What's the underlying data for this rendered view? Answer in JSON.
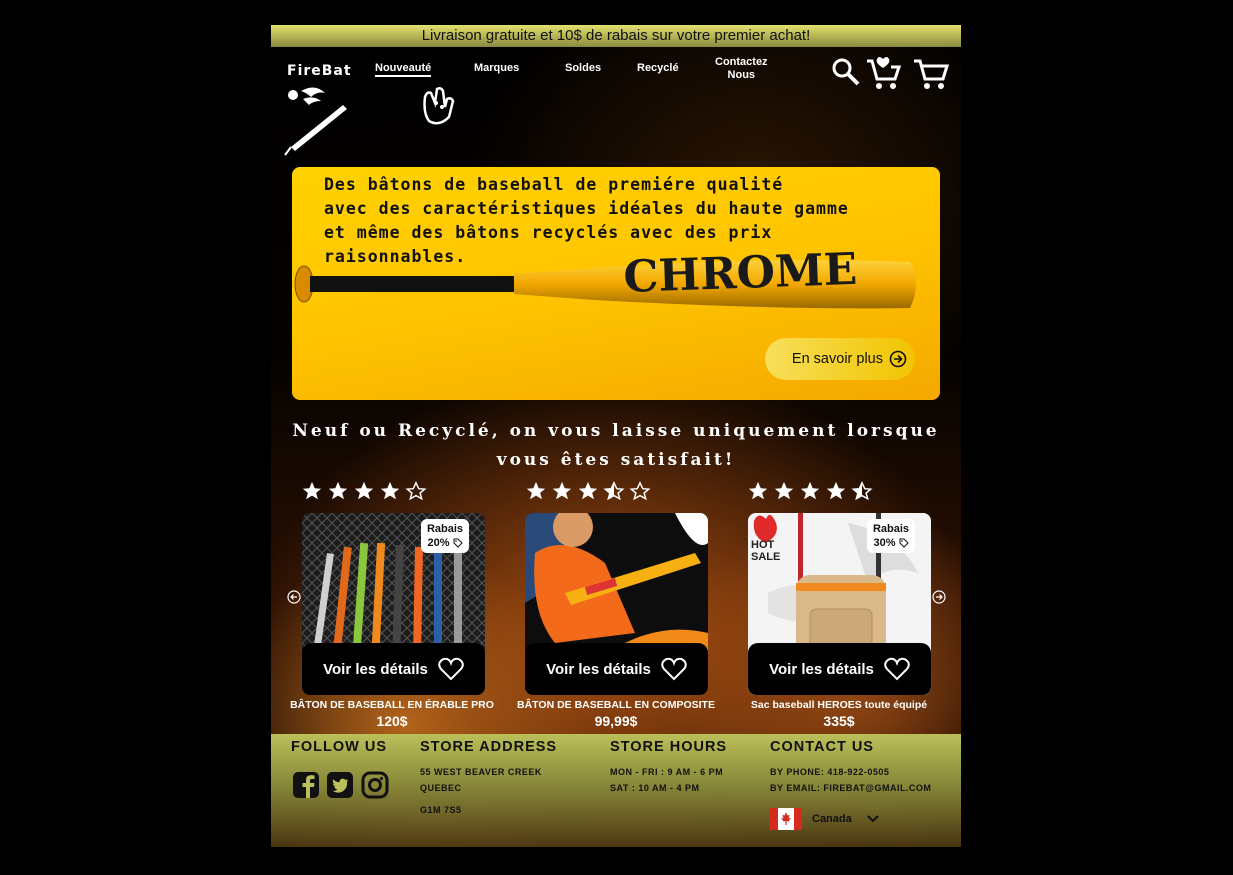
{
  "banner": {
    "text": "Livraison gratuite et 10$ de rabais sur votre premier achat!"
  },
  "logo": {
    "text": "FireBat"
  },
  "nav": {
    "items": [
      {
        "label": "Nouveauté",
        "active": true
      },
      {
        "label": "Marques"
      },
      {
        "label": "Soldes"
      },
      {
        "label": "Recyclé"
      },
      {
        "label_line1": "Contactez",
        "label_line2": "Nous"
      }
    ]
  },
  "header_icons": [
    "search-icon",
    "wishlist-cart-icon",
    "cart-icon",
    "glove-icon"
  ],
  "hero": {
    "line1": "Des bâtons de baseball de premiére qualité",
    "line2": "avec des caractéristiques idéales du haute  gamme",
    "line3": "et même des bâtons recyclés avec des prix",
    "line4": "raisonnables.",
    "bat_brand": "CHROME",
    "button_label": "En savoir plus"
  },
  "tagline": {
    "line1": "Neuf ou Recyclé, on vous laisse uniquement lorsque",
    "line2": "vous êtes satisfait!"
  },
  "products": [
    {
      "rating": 4,
      "badge_label": "Rabais",
      "badge_value": "20%",
      "details_label": "Voir les détails",
      "name": "BÂTON DE BASEBALL EN ÉRABLE PRO",
      "price": "120$"
    },
    {
      "rating": 3.5,
      "details_label": "Voir les détails",
      "name": "BÂTON DE BASEBALL EN COMPOSITE",
      "price": "99,99$"
    },
    {
      "rating": 4.5,
      "badge_label": "Rabais",
      "badge_value": "30%",
      "hot_label": "HOT",
      "sale_label": "SALE",
      "details_label": "Voir les détails",
      "name": "Sac baseball HEROES toute équipé",
      "price": "335$"
    }
  ],
  "footer": {
    "follow": {
      "title": "FOLLOW US",
      "icons": [
        "facebook-icon",
        "twitter-icon",
        "instagram-icon"
      ]
    },
    "address": {
      "title": "STORE ADDRESS",
      "line1": "55 WEST BEAVER CREEK",
      "line2": "QUEBEC",
      "line3": "G1M 7S5"
    },
    "hours": {
      "title": "STORE HOURS",
      "line1": "MON - FRI : 9 AM - 6 PM",
      "line2": "SAT : 10 AM - 4 PM"
    },
    "contact": {
      "title": "CONTACT US",
      "phone": "BY PHONE: 418-922-0505",
      "email": "BY EMAIL: FIREBAT@GMAIL.COM",
      "country": "Canada"
    }
  },
  "colors": {
    "hero_yellow": "#ffc400",
    "footer_olive": "#bcc05a",
    "banner": "#e3e06e"
  }
}
